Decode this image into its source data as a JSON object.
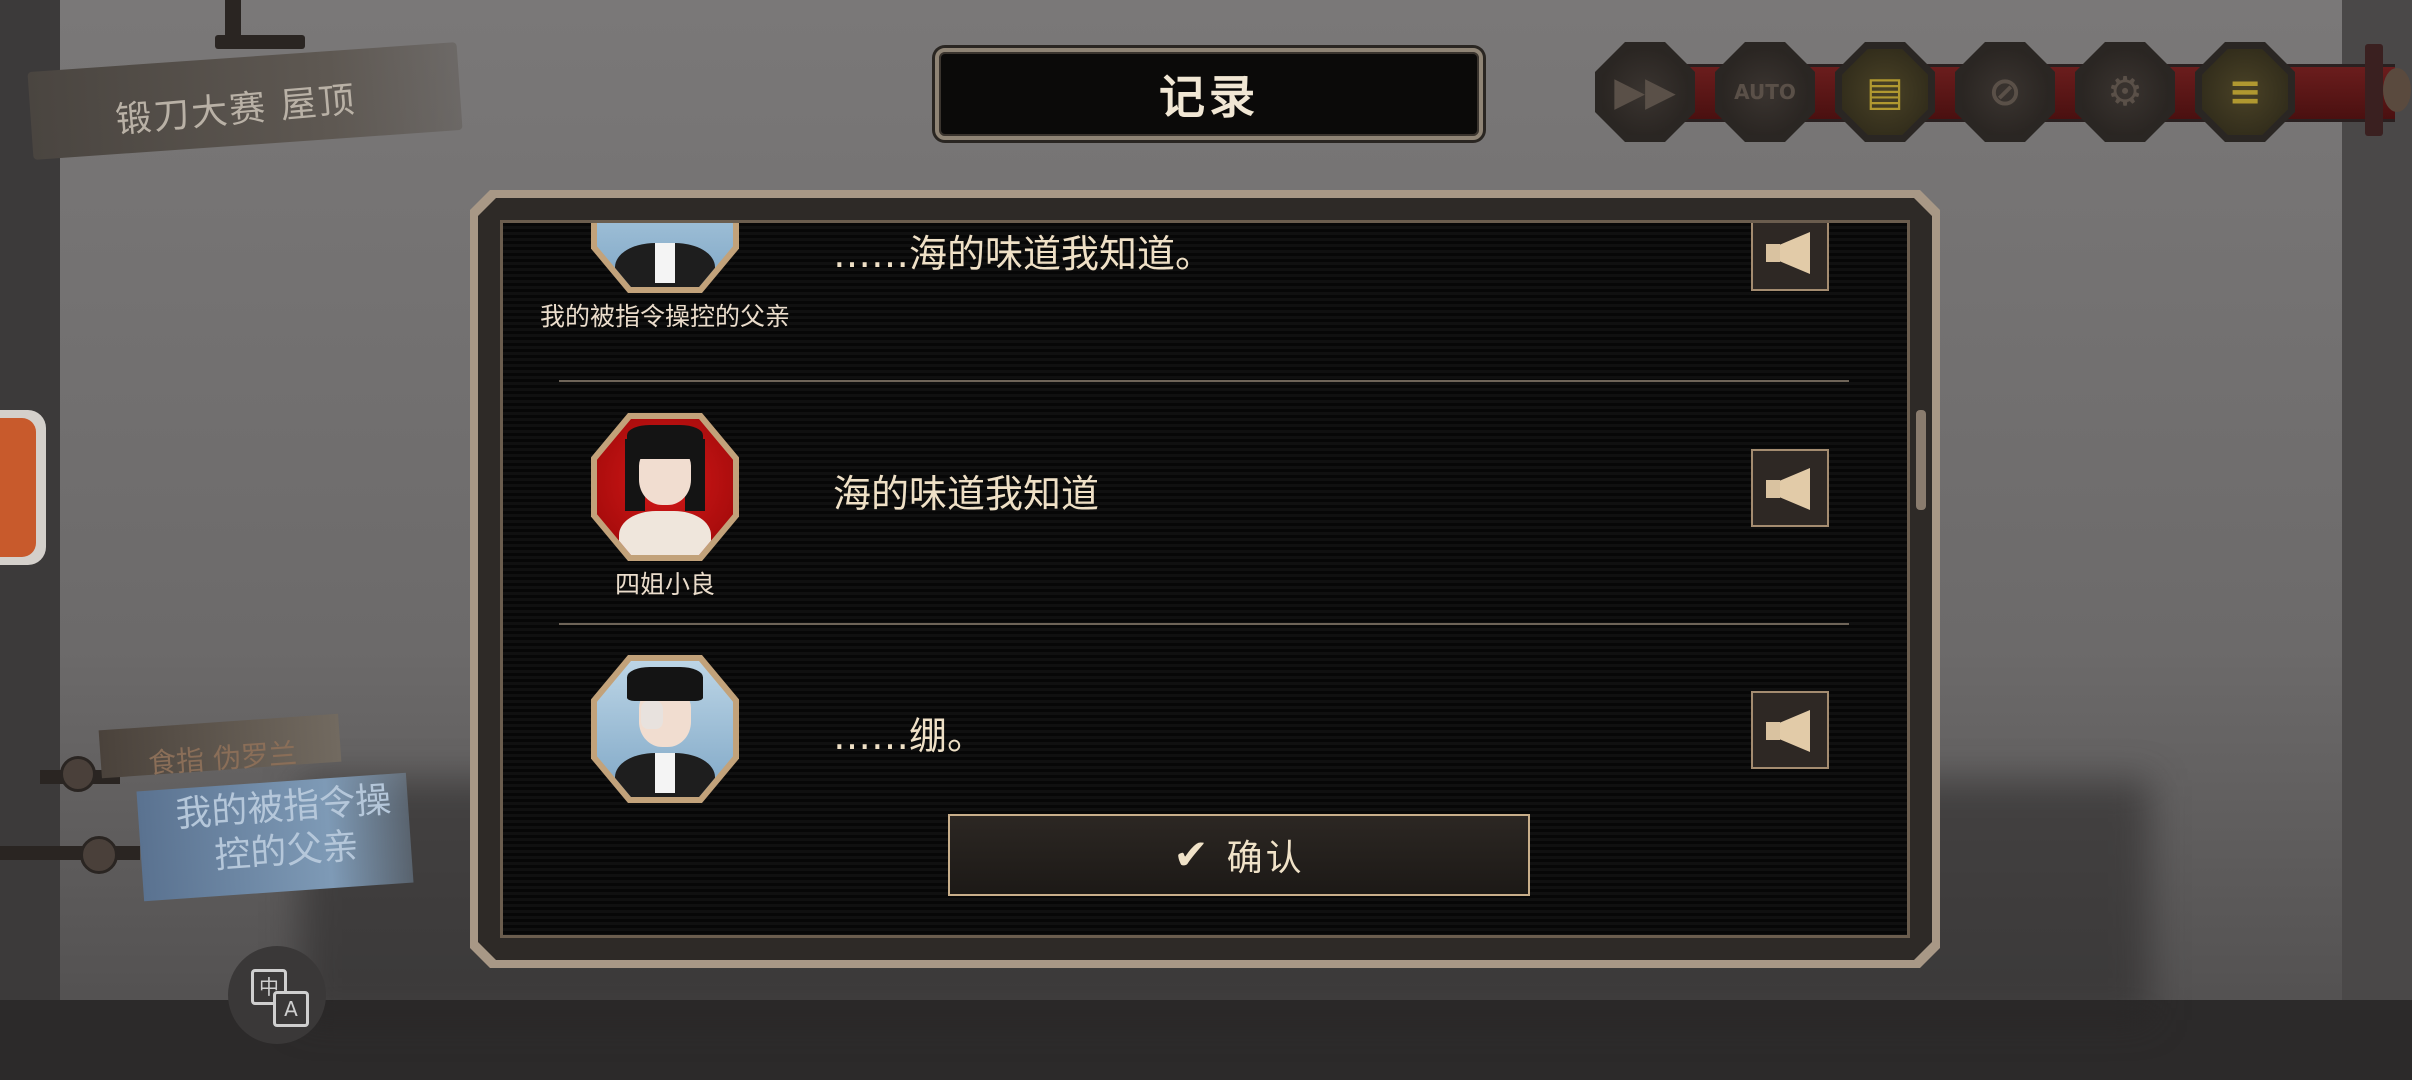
{
  "location": {
    "label": "锻刀大赛  屋顶"
  },
  "title": "记录",
  "toolbar": {
    "buttons": [
      {
        "name": "fast-forward",
        "glyph": "▶▶"
      },
      {
        "name": "auto",
        "glyph": "AUTO"
      },
      {
        "name": "log",
        "glyph": "▤"
      },
      {
        "name": "skip-off",
        "glyph": "⊘"
      },
      {
        "name": "settings",
        "glyph": "⚙"
      },
      {
        "name": "menu",
        "glyph": "≡"
      }
    ]
  },
  "log": {
    "entries": [
      {
        "speaker": "我的被指令操控的父亲",
        "text": "……海的味道我知道。"
      },
      {
        "speaker": "四姐小良",
        "text": "海的味道我知道"
      },
      {
        "speaker": "",
        "text": "……绷。"
      }
    ]
  },
  "confirm": {
    "label": "确认",
    "icon": "✔"
  },
  "nameplates": {
    "upper": "食指 伪罗兰",
    "lower": "我的被指令操控的父亲"
  },
  "translate": {
    "glyph_zh": "中",
    "glyph_en": "A"
  }
}
